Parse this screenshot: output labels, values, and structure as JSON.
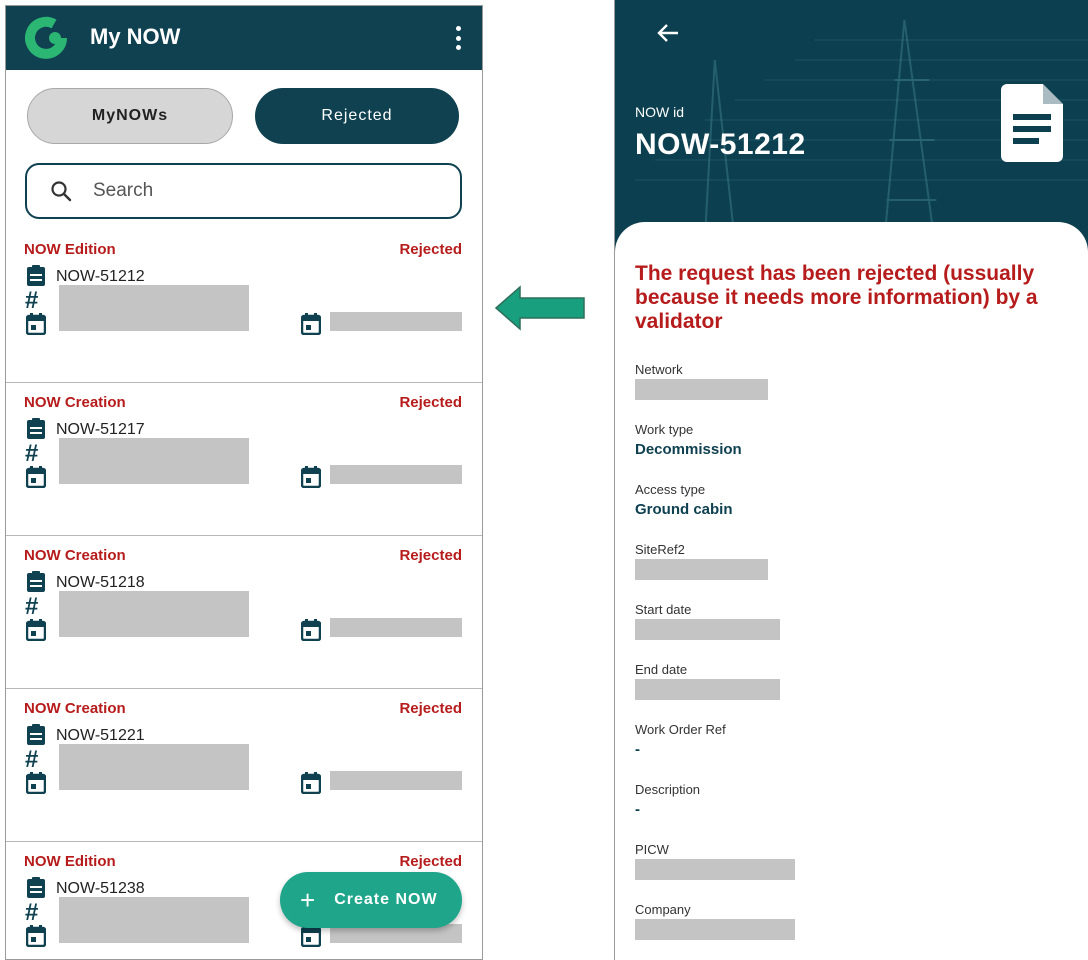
{
  "left": {
    "app_title": "My NOW",
    "tabs": {
      "mynows": "MyNOWs",
      "rejected": "Rejected"
    },
    "search_placeholder": "Search",
    "items": [
      {
        "type": "NOW Edition",
        "status": "Rejected",
        "id": "NOW-51212"
      },
      {
        "type": "NOW Creation",
        "status": "Rejected",
        "id": "NOW-51217"
      },
      {
        "type": "NOW Creation",
        "status": "Rejected",
        "id": "NOW-51218"
      },
      {
        "type": "NOW Creation",
        "status": "Rejected",
        "id": "NOW-51221"
      },
      {
        "type": "NOW Edition",
        "status": "Rejected",
        "id": "NOW-51238"
      }
    ],
    "fab_label": "Create NOW",
    "hash_symbol": "#"
  },
  "right": {
    "now_id_label": "NOW id",
    "now_id": "NOW-51212",
    "reject_message": "The request has been rejected (ussually because it needs more information) by a validator",
    "fields": {
      "network": {
        "label": "Network"
      },
      "work_type": {
        "label": "Work type",
        "value": "Decommission"
      },
      "access_type": {
        "label": "Access type",
        "value": "Ground cabin"
      },
      "siteref2": {
        "label": "SiteRef2"
      },
      "start_date": {
        "label": "Start date"
      },
      "end_date": {
        "label": "End date"
      },
      "work_order_ref": {
        "label": "Work Order Ref",
        "value": "-"
      },
      "description": {
        "label": "Description",
        "value": "-"
      },
      "picw": {
        "label": "PICW"
      },
      "company": {
        "label": "Company"
      }
    }
  },
  "colors": {
    "primary_dark": "#0f4151",
    "rejected_red": "#b71c1c",
    "fab_green": "#1fa58a",
    "arrow_green": "#18a07e"
  },
  "icons": [
    "logo-icon",
    "more-vert-icon",
    "search-icon",
    "clipboard-icon",
    "calendar-icon",
    "add-icon",
    "back-arrow-icon",
    "document-icon",
    "left-arrow-icon"
  ]
}
